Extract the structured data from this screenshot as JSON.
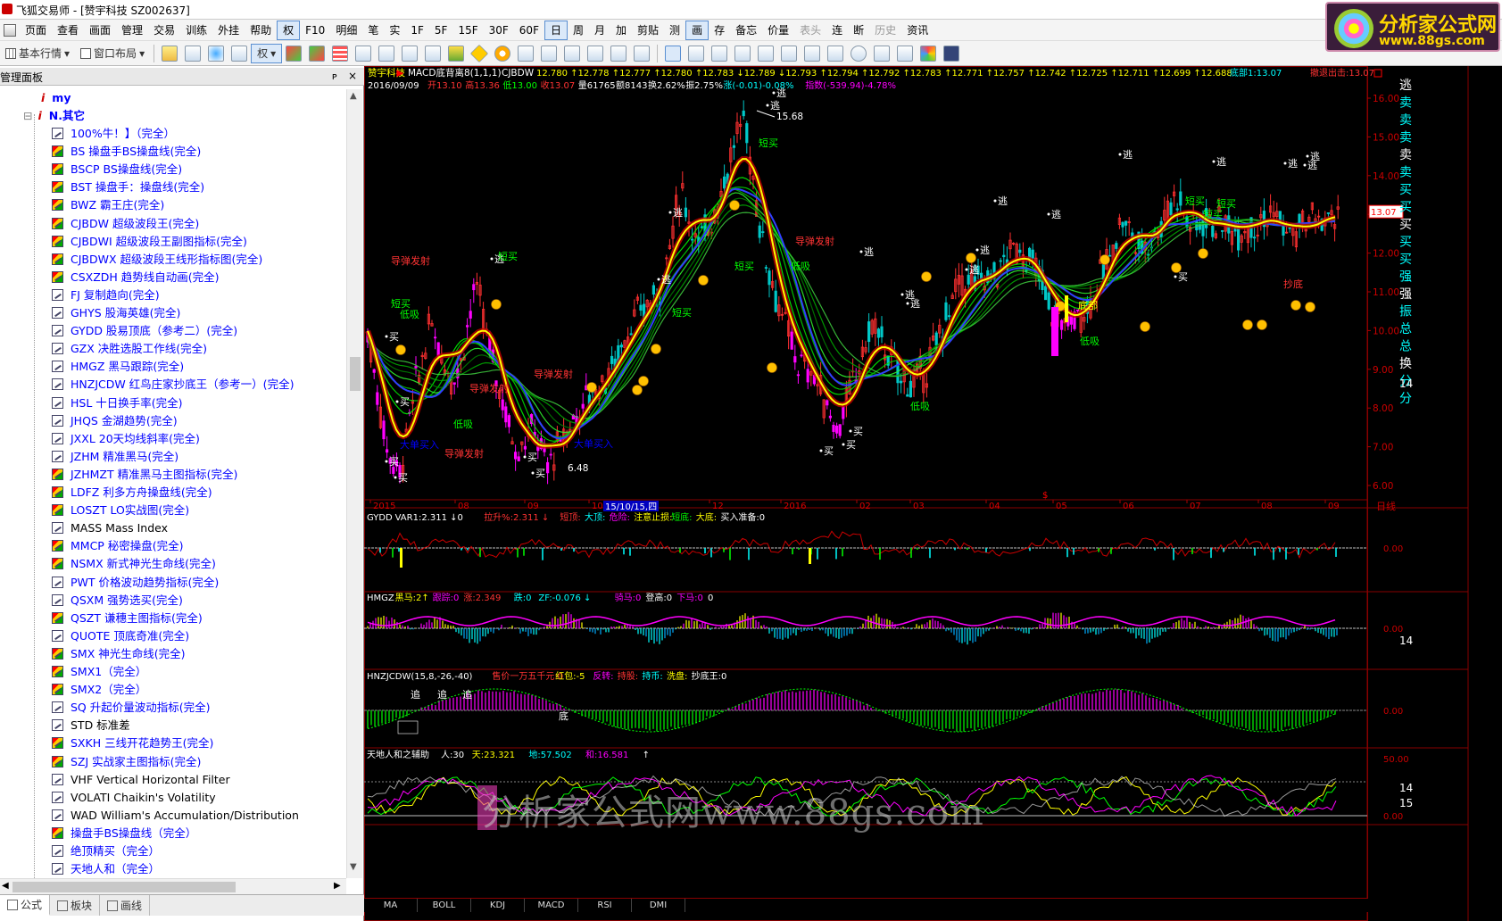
{
  "window": {
    "title": "飞狐交易师 - [赞宇科技 SZ002637]"
  },
  "menubar": {
    "items": [
      "页面",
      "查看",
      "画面",
      "管理",
      "交易",
      "训练",
      "外挂",
      "帮助",
      "权",
      "F10",
      "明细",
      "笔",
      "实",
      "1F",
      "5F",
      "15F",
      "30F",
      "60F",
      "日",
      "周",
      "月",
      "加",
      "剪贴",
      "测",
      "画",
      "存",
      "备忘",
      "价量",
      "表头",
      "连",
      "断",
      "历史",
      "资讯"
    ],
    "selected": [
      "权",
      "日",
      "画"
    ],
    "dim": [
      "表头",
      "历史"
    ]
  },
  "toolbar": {
    "basic_quote": "基本行情",
    "window_layout": "窗口布局",
    "quan": "权"
  },
  "logo": {
    "line1": "分析家公式网",
    "line2": "www.88gs.com"
  },
  "leftpanel": {
    "header": "管理面板",
    "pin": "ᴘ",
    "close": "×",
    "folders": [
      {
        "icon": "i",
        "label": "my",
        "fold": "○"
      },
      {
        "icon": "i",
        "label": "N.其它",
        "fold": "⊟"
      }
    ],
    "items": [
      {
        "label": "100%牛！】（完全）",
        "hot": false
      },
      {
        "label": "BS  操盘手BS操盘线(完全)",
        "hot": true
      },
      {
        "label": "BSCP  BS操盘线(完全)",
        "hot": true
      },
      {
        "label": "BST  操盘手：操盘线(完全)",
        "hot": true
      },
      {
        "label": "BWZ  霸王庄(完全)",
        "hot": true
      },
      {
        "label": "CJBDW  超级波段王(完全)",
        "hot": true
      },
      {
        "label": "CJBDWI  超级波段王副图指标(完全)",
        "hot": true
      },
      {
        "label": "CJBDWX  超级波段王线形指标图(完全)",
        "hot": true
      },
      {
        "label": "CSXZDH  趋势线自动画(完全)",
        "hot": true
      },
      {
        "label": "FJ  复制趋向(完全)",
        "hot": false
      },
      {
        "label": "GHYS  股海英雄(完全)",
        "hot": false
      },
      {
        "label": "GYDD  股易顶底（参考二）(完全)",
        "hot": false
      },
      {
        "label": "GZX  决胜选股工作线(完全)",
        "hot": false
      },
      {
        "label": "HMGZ  黑马跟踪(完全)",
        "hot": false
      },
      {
        "label": "HNZJCDW  红鸟庄家抄底王（参考一）(完全)",
        "hot": false
      },
      {
        "label": "HSL  十日换手率(完全)",
        "hot": false
      },
      {
        "label": "JHQS  金湖趋势(完全)",
        "hot": false
      },
      {
        "label": "JXXL  20天均线斜率(完全)",
        "hot": false
      },
      {
        "label": "JZHM  精准黑马(完全)",
        "hot": false
      },
      {
        "label": "JZHMZT  精准黑马主图指标(完全)",
        "hot": true
      },
      {
        "label": "LDFZ  利多方舟操盘线(完全)",
        "hot": true
      },
      {
        "label": "LOSZT  LO实战图(完全)",
        "hot": true
      },
      {
        "label": "MASS  Mass Index",
        "hot": false,
        "plain": true
      },
      {
        "label": "MMCP  秘密操盘(完全)",
        "hot": true
      },
      {
        "label": "NSMX  新式神光生命线(完全)",
        "hot": true
      },
      {
        "label": "PWT  价格波动趋势指标(完全)",
        "hot": false
      },
      {
        "label": "QSXM  强势选买(完全)",
        "hot": false
      },
      {
        "label": "QSZT  谦穗主图指标(完全)",
        "hot": true
      },
      {
        "label": "QUOTE  顶底奇准(完全)",
        "hot": false
      },
      {
        "label": "SMX  神光生命线(完全)",
        "hot": true
      },
      {
        "label": "SMX1（完全）",
        "hot": true
      },
      {
        "label": "SMX2（完全）",
        "hot": true
      },
      {
        "label": "SQ  升起价量波动指标(完全)",
        "hot": false
      },
      {
        "label": "STD  标准差",
        "hot": false,
        "plain": true
      },
      {
        "label": "SXKH  三线开花趋势王(完全)",
        "hot": true
      },
      {
        "label": "SZJ  实战家主图指标(完全)",
        "hot": true
      },
      {
        "label": "VHF  Vertical Horizontal Filter",
        "hot": false,
        "plain": true
      },
      {
        "label": "VOLATI  Chaikin's Volatility",
        "hot": false,
        "plain": true
      },
      {
        "label": "WAD  William's Accumulation/Distribution",
        "hot": false,
        "plain": true
      },
      {
        "label": "操盘手BS操盘线（完全）",
        "hot": true
      },
      {
        "label": "绝顶精买（完全）",
        "hot": false
      },
      {
        "label": "天地人和（完全）",
        "hot": false
      }
    ],
    "tabs": [
      "公式",
      "板块",
      "画线"
    ]
  },
  "chart": {
    "header1": {
      "stock": "赞宇科技",
      "indicator": "MACD底背离8(1,1,1)",
      "name": "CJBDW",
      "values": "12.780 ↑12.778 ↑12.777 ↑12.780 ↑12.783 ↓12.789 ↓12.793 ↑12.794 ↑12.792 ↑12.783 ↑12.771 ↑12.757 ↑12.742 ↑12.725 ↑12.711 ↑12.699 ↑12.688",
      "extra": "底部1:13.07",
      "extra2": "撤退出击:13.07"
    },
    "header2": {
      "date": "2016/09/09",
      "open": "开13.10",
      "high": "高13.36",
      "low": "低13.00",
      "close": "收13.07",
      "vol": "量61765",
      "amount": "额8143",
      "turnover": "换2.62%",
      "amp": "振2.75%",
      "chg": "涨(-0.01)-0.08%",
      "idx": "指数(-539.94)-4.78%"
    },
    "price_axis": [
      "16.00",
      "15.00",
      "14.00",
      "13.00",
      "12.00",
      "11.00",
      "10.00",
      "9.00",
      "8.00",
      "7.00",
      "6.00"
    ],
    "current_price": "13.07",
    "date_axis": [
      "2015",
      "08",
      "09",
      "10",
      "12",
      "2016",
      "02",
      "03",
      "04",
      "05",
      "06",
      "07",
      "08",
      "09"
    ],
    "cursor_date": "15/10/15,四",
    "period": "日线",
    "right_labels": [
      "逃",
      "卖",
      "卖",
      "卖",
      "卖",
      "卖",
      "买",
      "买",
      "买",
      "买",
      "买",
      "强",
      "强",
      "振",
      "总",
      "总",
      "换",
      "分",
      "分"
    ],
    "annotations": {
      "peak": "15.68",
      "trough": "6.48"
    },
    "signals": [
      "逃",
      "买",
      "短买",
      "低吸",
      "导弹发射",
      "抄底",
      "底部",
      "大单买入"
    ],
    "panels": [
      {
        "label": "GYDD",
        "parts": [
          {
            "t": "VAR1:2.311 ↓0",
            "c": "#fff"
          },
          {
            "t": "拉升%:2.311 ↓",
            "c": "#f33"
          },
          {
            "t": "短顶:",
            "c": "#f33"
          },
          {
            "t": "大顶:",
            "c": "#0ff"
          },
          {
            "t": "危险:",
            "c": "#f0f"
          },
          {
            "t": "注意止损:",
            "c": "#ff0"
          },
          {
            "t": "短底:",
            "c": "#0f0"
          },
          {
            "t": "大底:",
            "c": "#ff0"
          },
          {
            "t": "买入准备:0",
            "c": "#fff"
          }
        ],
        "zero": "0.00"
      },
      {
        "label": "HMGZ",
        "parts": [
          {
            "t": "黑马:2↑",
            "c": "#ff0"
          },
          {
            "t": "跟踪:0",
            "c": "#f0f"
          },
          {
            "t": "涨:2.349",
            "c": "#f33"
          },
          {
            "t": "跌:0",
            "c": "#0ff"
          },
          {
            "t": "ZF:-0.076 ↓",
            "c": "#0ff"
          },
          {
            "t": "骑马:0",
            "c": "#f0f"
          },
          {
            "t": "登高:0",
            "c": "#fff"
          },
          {
            "t": "下马:0",
            "c": "#f0f"
          },
          {
            "t": "0",
            "c": "#fff"
          }
        ],
        "zero": "0.00"
      },
      {
        "label": "HNZJCDW(15,8,-26,-40)",
        "parts": [
          {
            "t": "售价一万五千元:0",
            "c": "#f33"
          },
          {
            "t": "红包:-5",
            "c": "#ff0"
          },
          {
            "t": "反转:",
            "c": "#f0f"
          },
          {
            "t": "持股:",
            "c": "#f33"
          },
          {
            "t": "持币:",
            "c": "#0ff"
          },
          {
            "t": "洗盘:",
            "c": "#ff0"
          },
          {
            "t": "抄底王:0",
            "c": "#fff"
          }
        ],
        "zero": "0.00",
        "marks": [
          "追",
          "追",
          "追",
          "底"
        ]
      },
      {
        "label": "天地人和之辅助",
        "parts": [
          {
            "t": "人:30",
            "c": "#fff"
          },
          {
            "t": "天:23.321",
            "c": "#ff0"
          },
          {
            "t": "地:57.502",
            "c": "#0ff"
          },
          {
            "t": "和:16.581",
            "c": "#f0f"
          },
          {
            "t": "↑",
            "c": "#fff"
          }
        ],
        "top": "50.00",
        "zero": "0.00"
      }
    ],
    "side_numbers": [
      "14",
      "14",
      "14",
      "15"
    ],
    "bottom_tabs": [
      "MA",
      "BOLL",
      "KDJ",
      "MACD",
      "RSI",
      "DMI"
    ]
  },
  "watermark": "分析家公式网www.88gs.com",
  "colors": {
    "up": "#ff3030",
    "down": "#00d0d0",
    "ma": "#ffff00",
    "bg": "#000000",
    "border": "#800000"
  }
}
